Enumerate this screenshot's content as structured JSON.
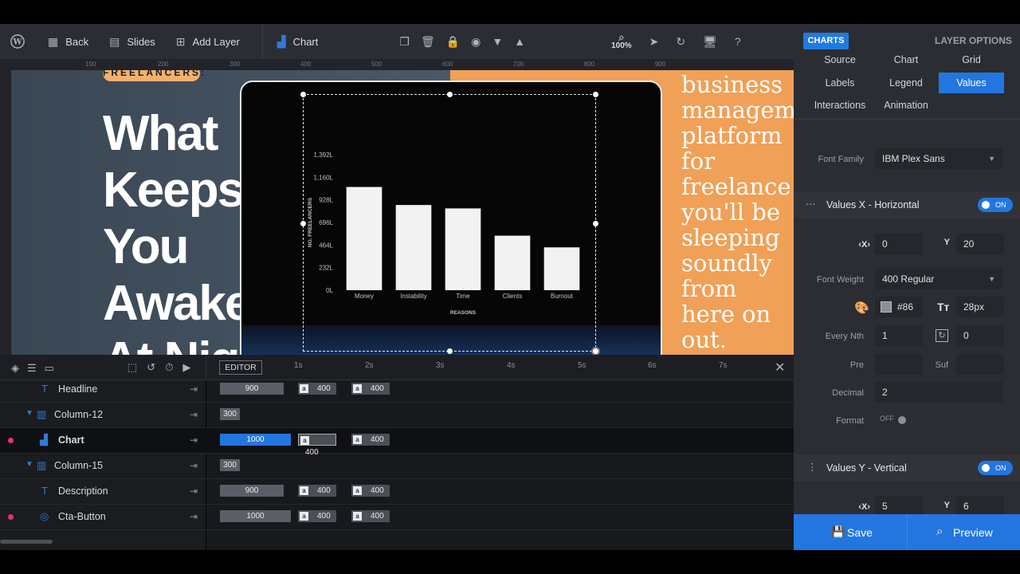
{
  "toolbar": {
    "back": "Back",
    "slides": "Slides",
    "add_layer": "Add Layer",
    "chart": "Chart",
    "zoom": "100%"
  },
  "ruler": {
    "ticks": [
      "100",
      "200",
      "300",
      "400",
      "500",
      "600",
      "700",
      "800",
      "900"
    ]
  },
  "canvas": {
    "tag": "FREELANCERS:",
    "headline": [
      "What",
      "Keeps",
      "You",
      "Awake",
      "At Night?"
    ],
    "right_text": [
      "business",
      "managem",
      "platform",
      "for",
      "freelance",
      "you'll be",
      "sleeping",
      "soundly",
      "from",
      "here on",
      "out."
    ]
  },
  "chart_data": {
    "type": "bar",
    "categories": [
      "Money",
      "Instability",
      "Time",
      "Clients",
      "Burnout"
    ],
    "values": [
      1060,
      875,
      840,
      560,
      440
    ],
    "ylabel": "NO. FREELANCERS",
    "xlabel": "REASONS",
    "yticks": [
      "0L",
      "232L",
      "464L",
      "696L",
      "928L",
      "1,160L",
      "1,392L"
    ],
    "ylim": [
      0,
      1392
    ],
    "bar_color": "#f2f2f2",
    "grid": false
  },
  "timeline": {
    "editor": "EDITOR",
    "seconds": [
      "1s",
      "2s",
      "3s",
      "4s",
      "5s",
      "6s",
      "7s"
    ],
    "rows": [
      {
        "label": "Headline",
        "bar": "900",
        "a1": "400",
        "a2": "400"
      },
      {
        "label": "Column-12",
        "bar": "300"
      },
      {
        "label": "Chart",
        "bar": "1000",
        "a1": "400",
        "a2": "400"
      },
      {
        "label": "Column-15",
        "bar": "300"
      },
      {
        "label": "Description",
        "bar": "900",
        "a1": "400",
        "a2": "400"
      },
      {
        "label": "Cta-Button",
        "bar": "1000",
        "a1": "400",
        "a2": "400"
      }
    ]
  },
  "panel": {
    "badge": "CHARTS",
    "layer_options": "LAYER OPTIONS",
    "tabs": [
      "Source",
      "Chart",
      "Grid",
      "Labels",
      "Legend",
      "Values",
      "Interactions",
      "Animation"
    ],
    "active_tab": "Values",
    "font_family_label": "Font Family",
    "font_family": "IBM Plex Sans",
    "sec_x": "Values X - Horizontal",
    "toggle_on": "ON",
    "x_label": "X",
    "y_label": "Y",
    "x_val": "0",
    "y_val": "20",
    "font_weight_label": "Font Weight",
    "font_weight": "400 Regular",
    "color_val": "#86",
    "font_size": "28px",
    "every_nth_label": "Every Nth",
    "every_nth": "1",
    "rotate": "0",
    "pre_label": "Pre",
    "suf_label": "Suf",
    "decimal_label": "Decimal",
    "decimal": "2",
    "format_label": "Format",
    "format_toggle": "OFF",
    "sec_y": "Values Y - Vertical",
    "x2_val": "5",
    "y2_val": "6",
    "save": "Save",
    "preview": "Preview"
  }
}
